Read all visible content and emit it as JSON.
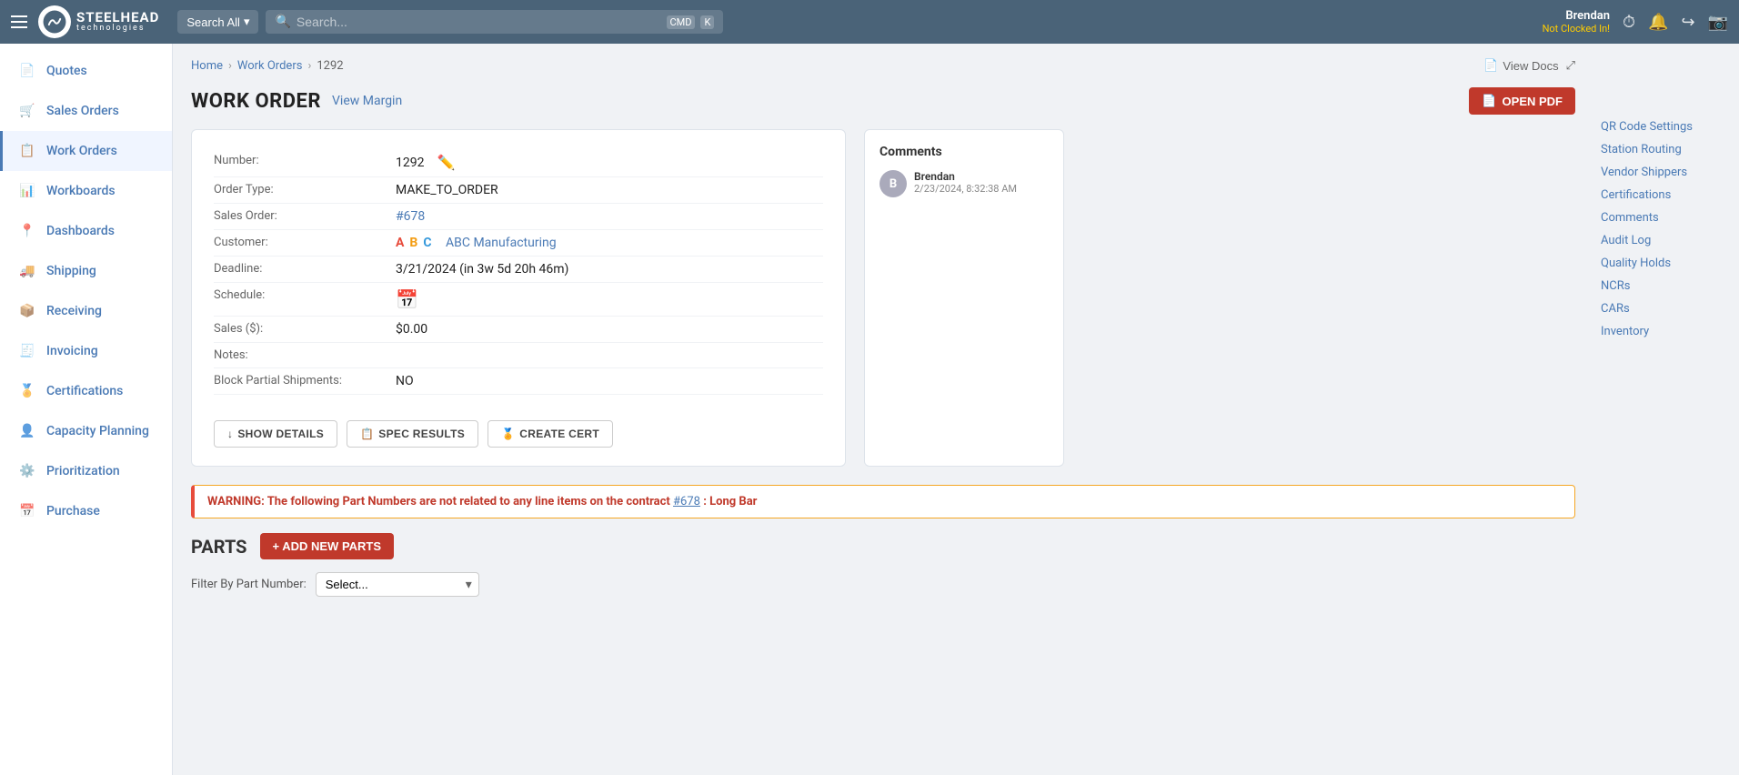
{
  "nav": {
    "brand": "STEELHEAD",
    "sub": "technologies",
    "search_all_label": "Search All",
    "search_placeholder": "Search...",
    "kbd1": "CMD",
    "kbd2": "K",
    "user_name": "Brendan",
    "user_status": "Not Clocked In!"
  },
  "sidebar": {
    "items": [
      {
        "id": "quotes",
        "label": "Quotes",
        "icon": "📄"
      },
      {
        "id": "sales-orders",
        "label": "Sales Orders",
        "icon": "🛒"
      },
      {
        "id": "work-orders",
        "label": "Work Orders",
        "icon": "📋"
      },
      {
        "id": "workboards",
        "label": "Workboards",
        "icon": "📊"
      },
      {
        "id": "dashboards",
        "label": "Dashboards",
        "icon": "📍"
      },
      {
        "id": "shipping",
        "label": "Shipping",
        "icon": "🚚"
      },
      {
        "id": "receiving",
        "label": "Receiving",
        "icon": "📦"
      },
      {
        "id": "invoicing",
        "label": "Invoicing",
        "icon": "🧾"
      },
      {
        "id": "certifications",
        "label": "Certifications",
        "icon": "🏅"
      },
      {
        "id": "capacity-planning",
        "label": "Capacity Planning",
        "icon": "👤"
      },
      {
        "id": "prioritization",
        "label": "Prioritization",
        "icon": "⚙️"
      },
      {
        "id": "purchase",
        "label": "Purchase",
        "icon": "📅"
      }
    ]
  },
  "breadcrumb": {
    "home": "Home",
    "work_orders": "Work Orders",
    "current": "1292",
    "view_docs": "View Docs"
  },
  "page": {
    "title": "WORK ORDER",
    "view_margin": "View Margin",
    "open_pdf": "OPEN PDF"
  },
  "work_order": {
    "number_label": "Number:",
    "number_value": "1292",
    "order_type_label": "Order Type:",
    "order_type_value": "MAKE_TO_ORDER",
    "sales_order_label": "Sales Order:",
    "sales_order_value": "#678",
    "customer_label": "Customer:",
    "customer_value": "ABC Manufacturing",
    "deadline_label": "Deadline:",
    "deadline_value": "3/21/2024 (in 3w 5d 20h 46m)",
    "schedule_label": "Schedule:",
    "sales_label": "Sales ($):",
    "sales_value": "$0.00",
    "notes_label": "Notes:",
    "block_label": "Block Partial Shipments:",
    "block_value": "NO",
    "btn_show_details": "SHOW DETAILS",
    "btn_spec_results": "SPEC RESULTS",
    "btn_create_cert": "CREATE CERT"
  },
  "comments": {
    "title": "Comments",
    "items": [
      {
        "author": "Brendan",
        "avatar": "B",
        "time": "2/23/2024, 8:32:38 AM",
        "text": ""
      }
    ]
  },
  "right_links": [
    "QR Code Settings",
    "Station Routing",
    "Vendor Shippers",
    "Certifications",
    "Comments",
    "Audit Log",
    "Quality Holds",
    "NCRs",
    "CARs",
    "Inventory"
  ],
  "warning": {
    "text_pre": "WARNING: The following Part Numbers are not related to any line items on the contract ",
    "link": "#678",
    "text_post": ": Long Bar"
  },
  "parts": {
    "title": "PARTS",
    "add_btn": "+ ADD NEW PARTS",
    "filter_label": "Filter By Part Number:",
    "filter_placeholder": "Select..."
  }
}
